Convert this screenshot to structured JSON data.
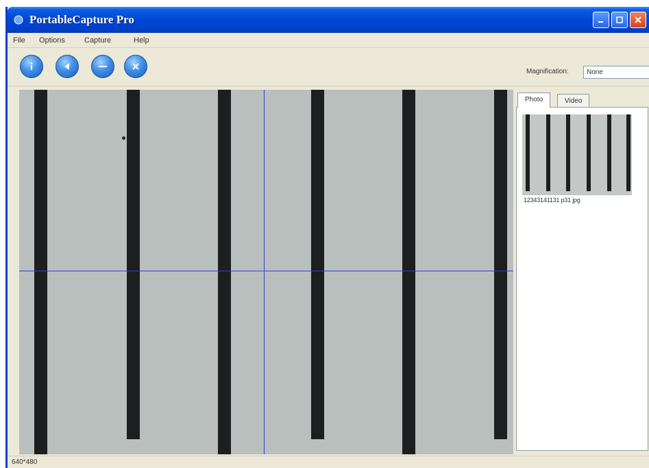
{
  "window": {
    "title": "PortableCapture Pro"
  },
  "menu": {
    "items": [
      "File",
      "Options",
      "Capture",
      "Help"
    ]
  },
  "toolbar": {
    "buttons": [
      "info-icon",
      "back-icon",
      "record-icon",
      "settings-icon"
    ],
    "magnification_label": "Magnification:",
    "magnification_value": "None"
  },
  "tabs": [
    "Photo",
    "Video"
  ],
  "gallery": {
    "caption": "12343141131 p31 jpg"
  },
  "status": {
    "text": "640*480"
  },
  "colors": {
    "titlebar": "#0047d6",
    "crosshair": "#3b3bdc",
    "stripe": "#1c1e1f",
    "specimen": "#b8bfbd"
  }
}
